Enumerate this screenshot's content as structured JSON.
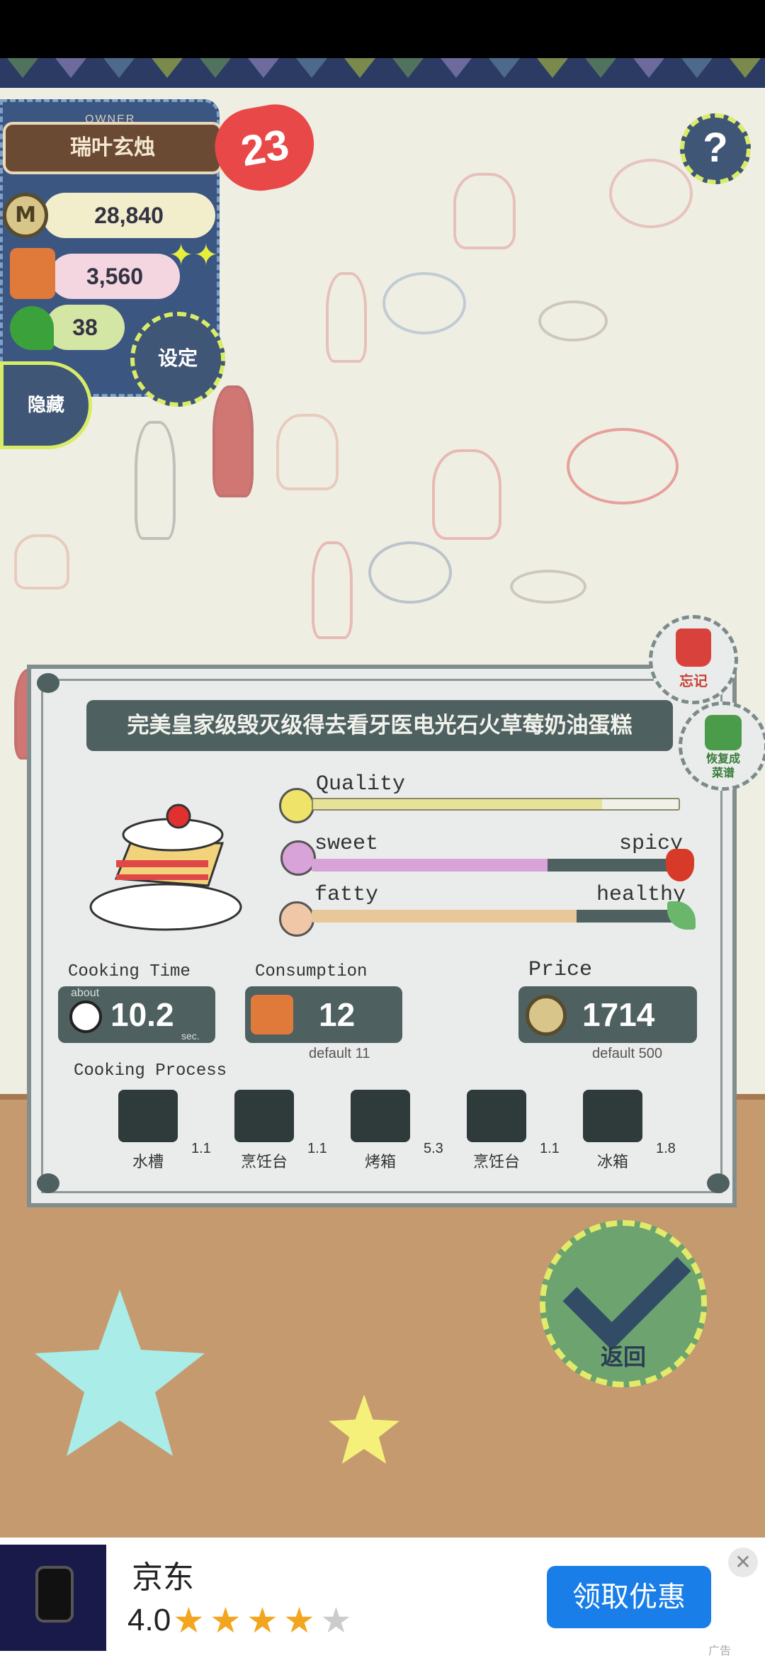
{
  "owner": {
    "caption": "OWNER",
    "name": "瑞叶玄烛",
    "level": "23",
    "coins": "28,840",
    "food": "3,560",
    "clover": "38",
    "coin_icon_letter": "M"
  },
  "buttons": {
    "settings": "设定",
    "hide": "隐藏",
    "help": "?",
    "forget": "忘记",
    "restore_line1": "恢复成",
    "restore_line2": "菜谱",
    "back": "返回"
  },
  "recipe": {
    "title": "完美皇家级毁灭级得去看牙医电光石火草莓奶油蛋糕",
    "quality_label": "Quality",
    "quality": 0.79,
    "sweet_label": "sweet",
    "spicy_label": "spicy",
    "sweet": 0.64,
    "fatty_label": "fatty",
    "healthy_label": "healthy",
    "fatty": 0.72,
    "cooking_time_label": "Cooking Time",
    "about_label": "about",
    "cooking_time": "10.2",
    "sec_label": "sec.",
    "consumption_label": "Consumption",
    "consumption": "12",
    "consumption_default": "default 11",
    "price_label": "Price",
    "price": "1714",
    "price_default": "default 500",
    "process_label": "Cooking Process",
    "process": [
      {
        "label": "水槽",
        "time": "1.1",
        "icon": "faucet-icon"
      },
      {
        "label": "烹饪台",
        "time": "1.1",
        "icon": "knife-icon"
      },
      {
        "label": "烤箱",
        "time": "5.3",
        "icon": "oven-icon"
      },
      {
        "label": "烹饪台",
        "time": "1.1",
        "icon": "knife-icon"
      },
      {
        "label": "冰箱",
        "time": "1.8",
        "icon": "fridge-icon"
      }
    ]
  },
  "ad": {
    "title": "京东",
    "rating": "4.0",
    "stars_filled": 4,
    "stars_total": 5,
    "cta": "领取优惠",
    "close": "✕",
    "tag": "广告"
  },
  "colors": {
    "panel": "#4e6160",
    "quality_fill": "#e6e29a",
    "sweet_fill": "#d7a3d8",
    "fatty_fill": "#e8c798",
    "accent_green": "#d8ec68"
  }
}
